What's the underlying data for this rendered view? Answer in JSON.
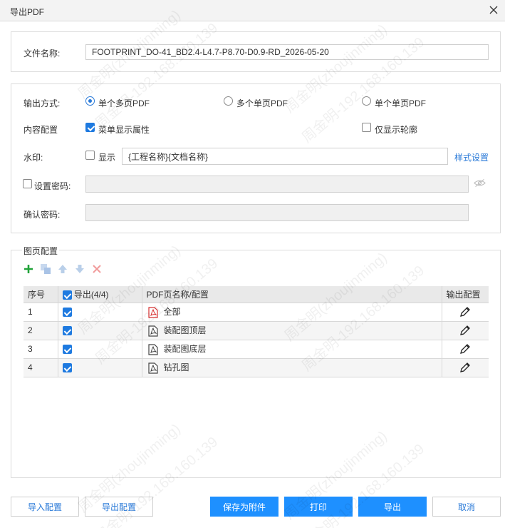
{
  "window": {
    "title": "导出PDF"
  },
  "file": {
    "label": "文件名称:",
    "value": "FOOTPRINT_DO-41_BD2.4-L4.7-P8.70-D0.9-RD_2026-05-20"
  },
  "output": {
    "label": "输出方式:",
    "options": [
      "单个多页PDF",
      "多个单页PDF",
      "单个单页PDF"
    ],
    "selected": 0
  },
  "content": {
    "label": "内容配置",
    "menu_attr": {
      "label": "菜单显示属性",
      "checked": true
    },
    "outline_only": {
      "label": "仅显示轮廓",
      "checked": false
    }
  },
  "watermark": {
    "label": "水印:",
    "show_label": "显示",
    "show_checked": false,
    "value": "{工程名称}{文档名称}",
    "style_link": "样式设置"
  },
  "password": {
    "label": "设置密码:",
    "checked": false,
    "value": ""
  },
  "confirm": {
    "label": "确认密码:",
    "value": ""
  },
  "pages": {
    "section_label": "图页配置",
    "columns": {
      "index": "序号",
      "export": "导出(4/4)",
      "name": "PDF页名称/配置",
      "config": "输出配置"
    },
    "rows": [
      {
        "index": "1",
        "name": "全部",
        "checked": true
      },
      {
        "index": "2",
        "name": "装配图顶层",
        "checked": true
      },
      {
        "index": "3",
        "name": "装配图底层",
        "checked": true
      },
      {
        "index": "4",
        "name": "钻孔图",
        "checked": true
      }
    ]
  },
  "buttons": {
    "import": "导入配置",
    "export_cfg": "导出配置",
    "save_attach": "保存为附件",
    "print": "打印",
    "export": "导出",
    "cancel": "取消"
  },
  "colors": {
    "accent": "#1e90ff",
    "link": "#2a7ad8",
    "add": "#22a33a",
    "delete": "#e05050"
  },
  "watermark_text": [
    "周金明(zhoujinming)",
    "周金明-192.168.160.139"
  ]
}
